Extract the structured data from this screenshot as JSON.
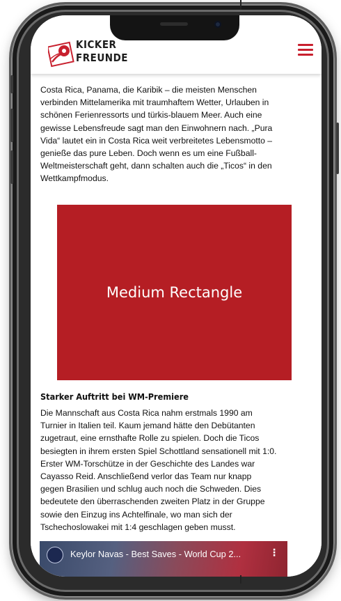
{
  "brand": {
    "name_line1": "KICKER",
    "name_line2": "FREUNDE",
    "accent": "#c8202e",
    "logo_icon": "soccer-ball-icon"
  },
  "header": {
    "menu_icon": "hamburger-menu-icon"
  },
  "article": {
    "intro": "Costa Rica, Panama, die Karibik – die meisten Menschen\nverbinden Mittelamerika mit traumhaftem Wetter, Urlauben in\nschönen Ferienressorts und türkis-blauem Meer. Auch eine\ngewisse Lebensfreude sagt man den Einwohnern nach. „Pura\nVida“ lautet ein in Costa Rica weit verbreitetes Lebensmotto –\ngenieße das pure Leben. Doch wenn es um eine Fußball-\nWeltmeisterschaft geht, dann schalten auch die „Ticos“ in den\nWettkampfmodus.",
    "ad_label": "Medium Rectangle",
    "ad_color": "#b51e24",
    "section_heading": "Starker Auftritt bei WM-Premiere",
    "section_body": "Die Mannschaft aus Costa Rica nahm erstmals 1990 am\nTurnier in Italien teil. Kaum jemand hätte den Debütanten\nzugetraut, eine ernsthafte Rolle zu spielen. Doch die Ticos\nbesiegten in ihrem ersten Spiel Schottland sensationell mit 1:0.\nErster WM-Torschütze in der Geschichte des Landes war\nCayasso Reid. Anschließend verlor das Team nur knapp\ngegen Brasilien und schlug auch noch die Schweden. Dies\nbedeutete den überraschenden zweiten Platz in der Gruppe\nsowie den Einzug ins Achtelfinale, wo man sich der\nTschechoslowakei mit 1:4 geschlagen geben musst."
  },
  "video": {
    "title": "Keylor Navas - Best Saves - World Cup 2...",
    "more_label": "⋮"
  }
}
